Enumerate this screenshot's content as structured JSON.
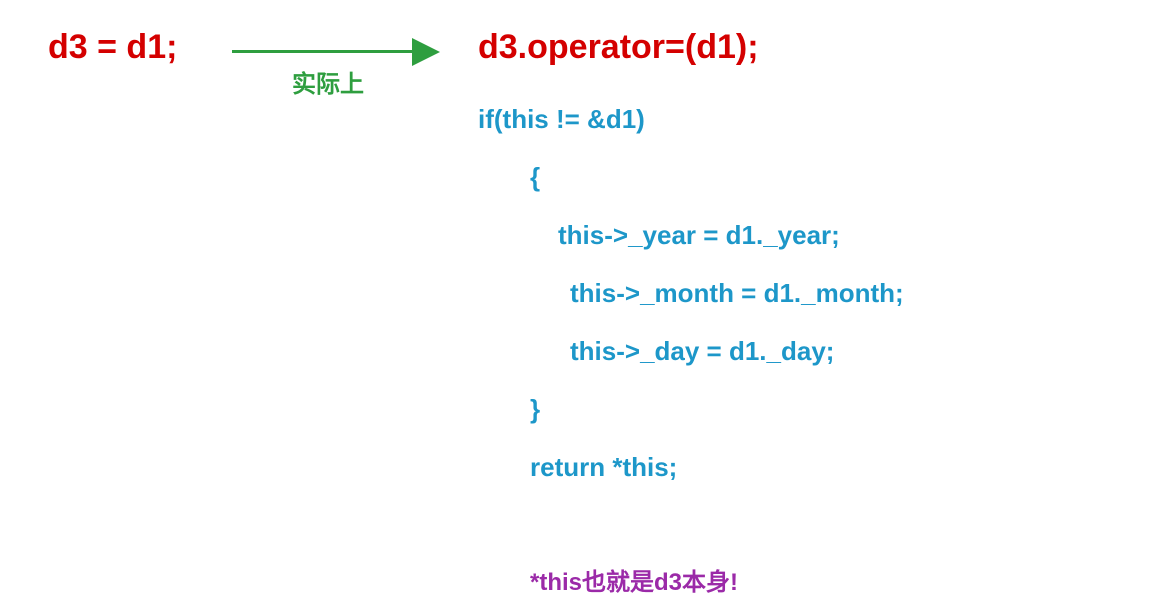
{
  "left": {
    "expr": "d3 = d1;"
  },
  "arrow": {
    "label": "实际上"
  },
  "right": {
    "title": "d3.operator=(d1);"
  },
  "code": {
    "l0": "if(this != &d1)",
    "l1": "{",
    "l2": "this->_year = d1._year;",
    "l3": "this->_month = d1._month;",
    "l4": "this->_day = d1._day;",
    "l5": "}",
    "l6": "return *this;"
  },
  "note": "*this也就是d3本身!"
}
